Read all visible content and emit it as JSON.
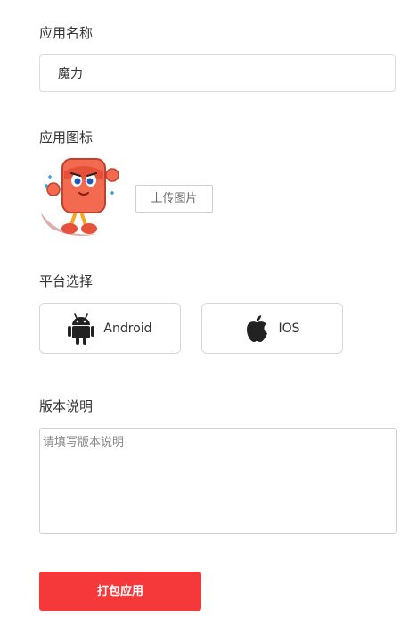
{
  "app_name": {
    "label": "应用名称",
    "value": "魔力"
  },
  "app_icon": {
    "label": "应用图标",
    "upload_label": "上传图片",
    "icon": "cartoon-mascot-icon"
  },
  "platform": {
    "label": "平台选择",
    "options": [
      {
        "label": "Android",
        "icon": "android-icon"
      },
      {
        "label": "IOS",
        "icon": "apple-icon"
      }
    ]
  },
  "version_notes": {
    "label": "版本说明",
    "placeholder": "请填写版本说明",
    "value": ""
  },
  "submit": {
    "label": "打包应用"
  },
  "colors": {
    "primary": "#f5393b",
    "border": "#dcdcdc",
    "text": "#333333"
  }
}
